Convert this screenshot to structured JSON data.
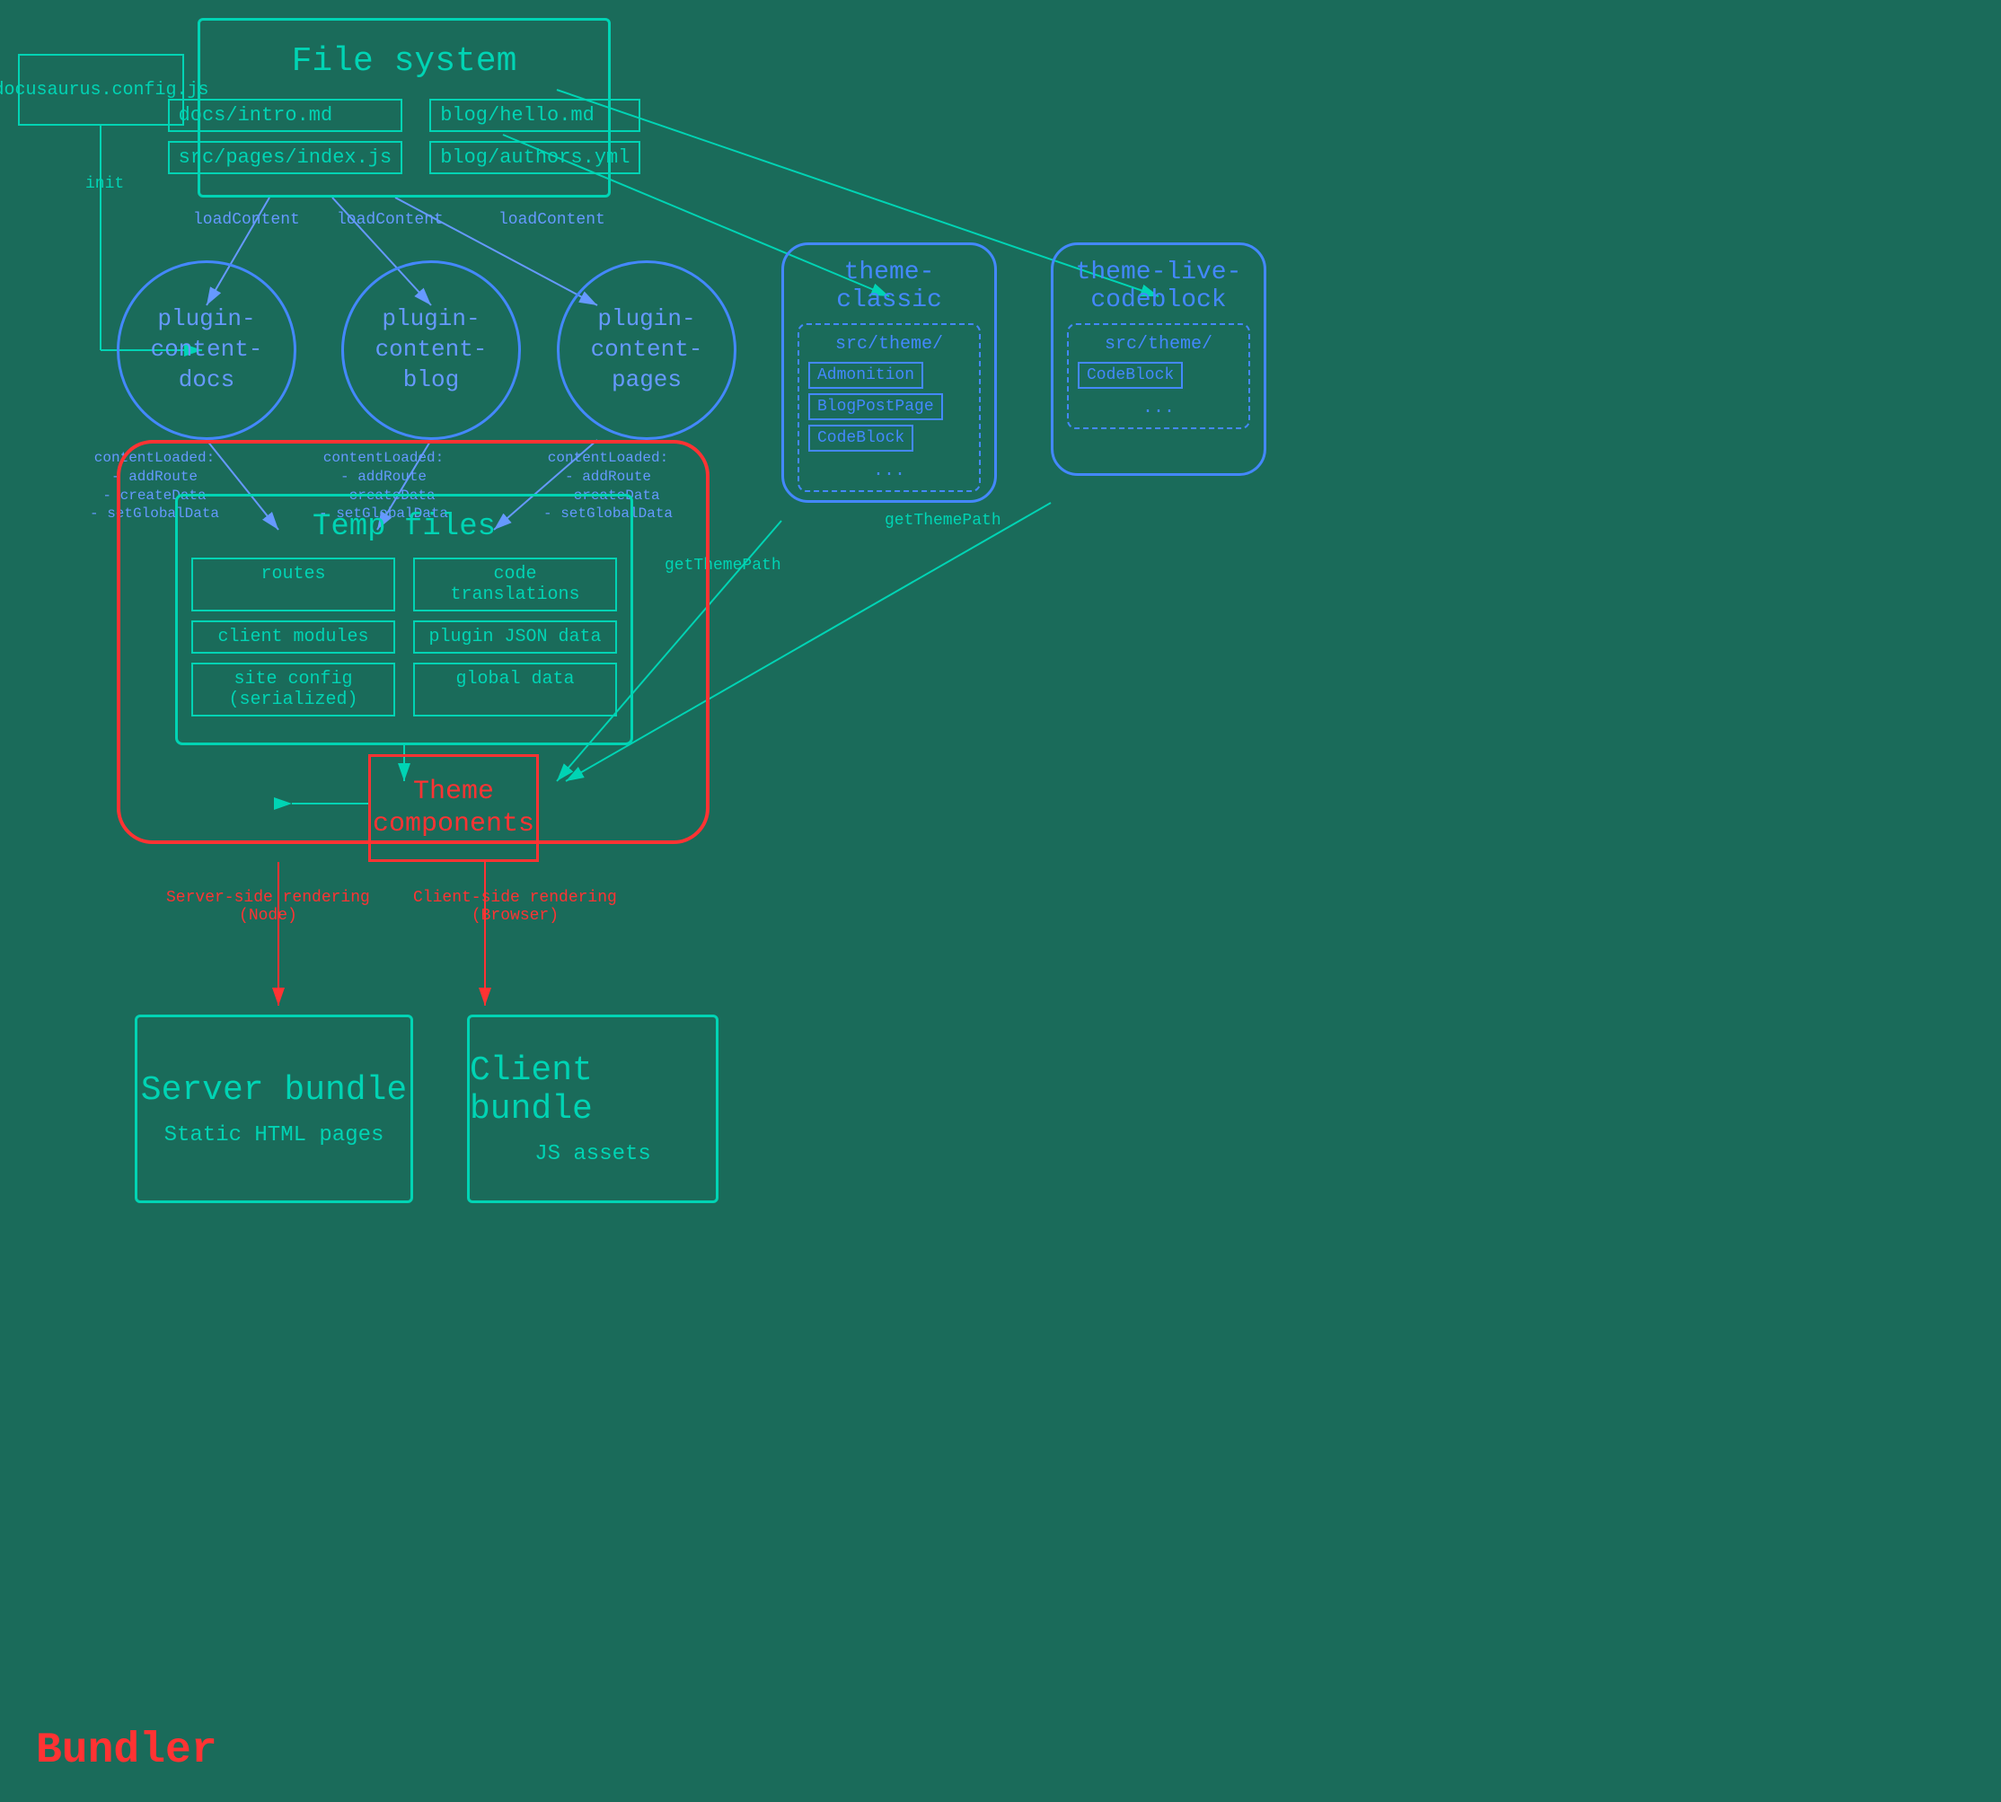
{
  "background_color": "#1a6b5a",
  "file_system": {
    "title": "File system",
    "files": [
      "docs/intro.md",
      "blog/hello.md",
      "src/pages/index.js",
      "blog/authors.yml"
    ]
  },
  "config": {
    "label": "docusaurus.config.js"
  },
  "plugins": [
    {
      "id": "docs",
      "label": "plugin-\ncontent-\ndocs"
    },
    {
      "id": "blog",
      "label": "plugin-\ncontent-\nblog"
    },
    {
      "id": "pages",
      "label": "plugin-\ncontent-\npage"
    }
  ],
  "theme_classic": {
    "title": "theme-classic",
    "src_label": "src/theme/",
    "components": [
      "Admonition",
      "BlogPostPage",
      "CodeBlock"
    ],
    "dots": "..."
  },
  "theme_live": {
    "title": "theme-live-\ncodeblock",
    "src_label": "src/theme/",
    "components": [
      "CodeBlock"
    ],
    "dots": "..."
  },
  "temp_files": {
    "title": "Temp files",
    "items": [
      "routes",
      "code translations",
      "client modules",
      "plugin JSON data",
      "site config (serialized)",
      "global data"
    ]
  },
  "bundler": {
    "label": "Bundler"
  },
  "theme_components": {
    "label": "Theme\ncomponents"
  },
  "server_bundle": {
    "title": "Server bundle",
    "subtitle": "Static HTML pages"
  },
  "client_bundle": {
    "title": "Client bundle",
    "subtitle": "JS assets"
  },
  "arrows": {
    "init": "init",
    "load_content_1": "loadContent",
    "load_content_2": "loadContent",
    "load_content_3": "loadContent",
    "content_loaded_docs": "contentLoaded:\n- addRoute\n- createData\n- setGlobalData",
    "content_loaded_blog": "contentLoaded:\n- addRoute\n- createData\n- setGlobalData",
    "content_loaded_pages": "contentLoaded:\n- addRoute\n- createData\n- setGlobalData",
    "get_theme_path_1": "getThemePath",
    "get_theme_path_2": "getThemePath",
    "server_side": "Server-side rendering\n(Node)",
    "client_side": "Client-side rendering\n(Browser)"
  }
}
